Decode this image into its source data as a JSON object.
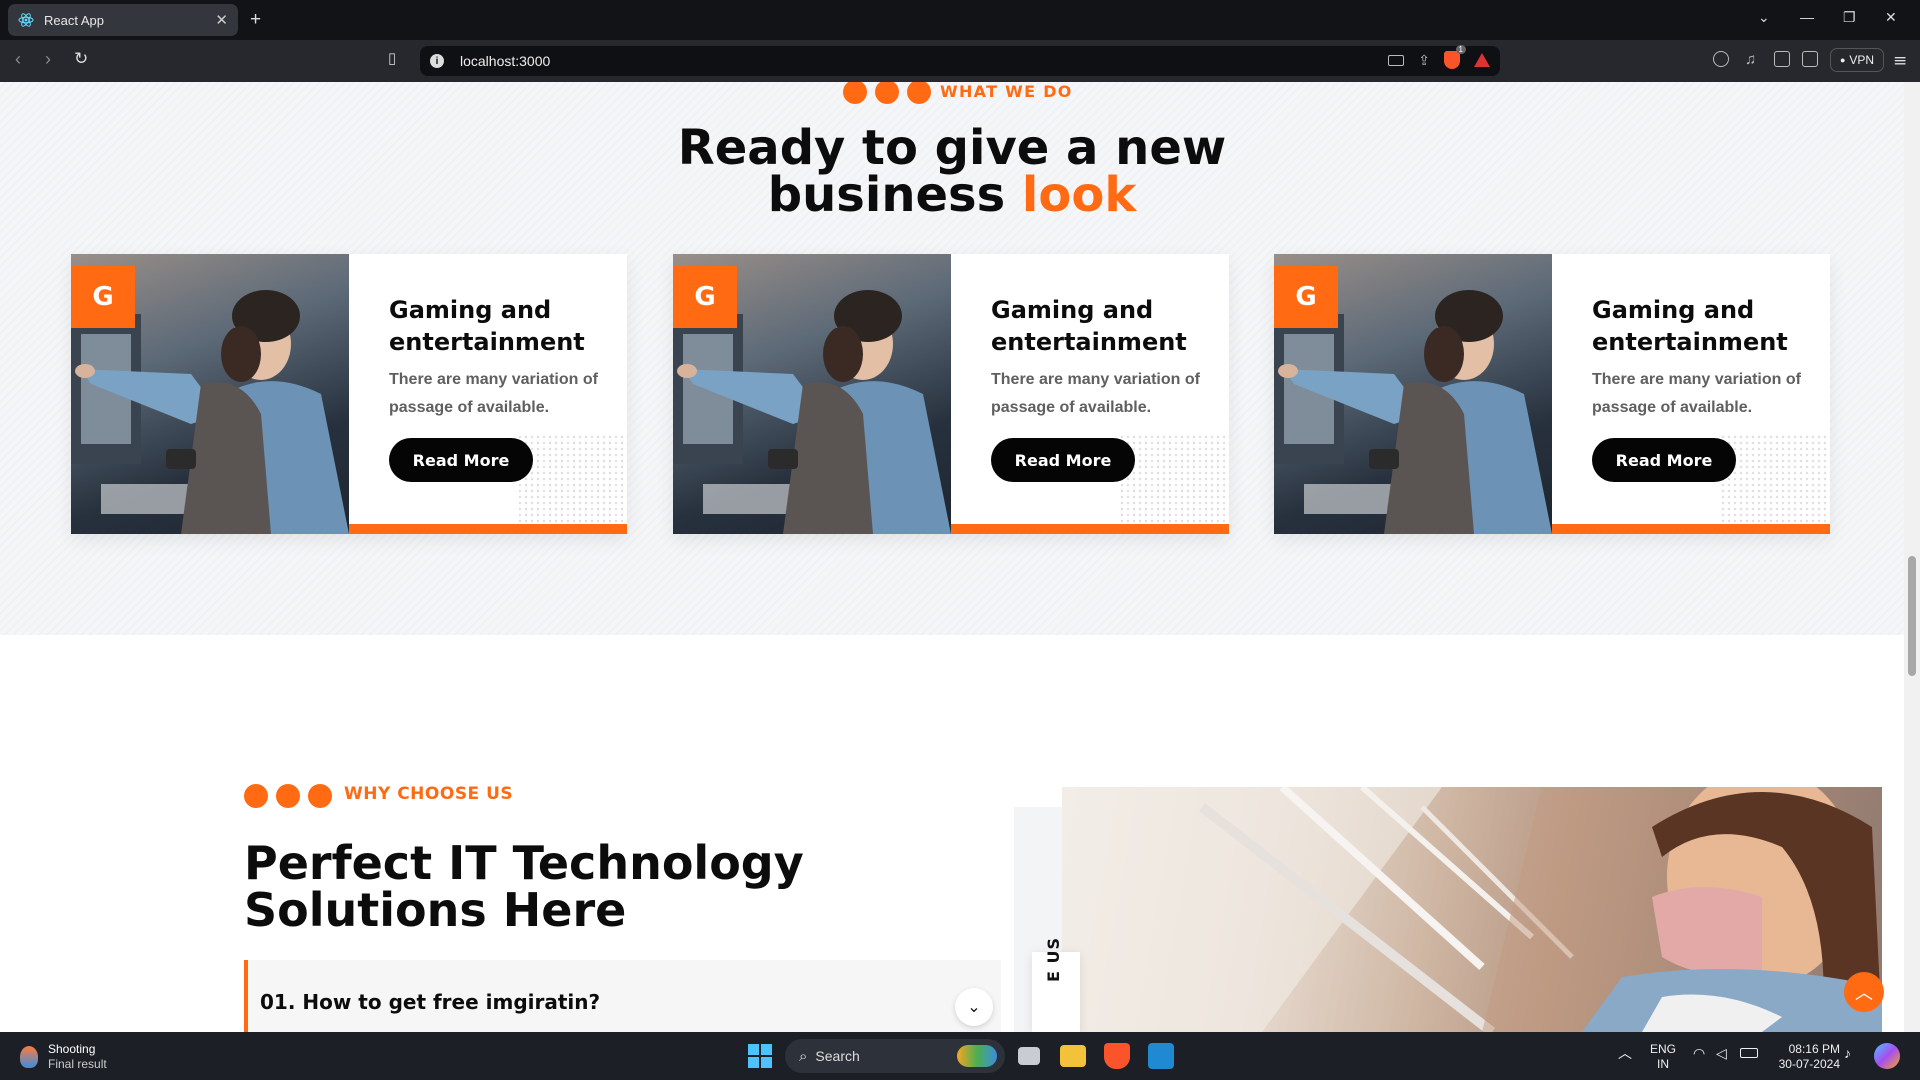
{
  "browser": {
    "tab_title": "React App",
    "tab_close": "✕",
    "new_tab": "+",
    "url": "localhost:3000",
    "vpn_label": "VPN",
    "brave_badge_count": "1"
  },
  "section_services": {
    "eyebrow": "WHAT WE DO",
    "title_line1": "Ready to give a new",
    "title_line2_plain": "business",
    "title_line2_accent": "look",
    "cards": [
      {
        "badge": "G",
        "title": "Gaming and entertainment",
        "description": "There are many variation of passage of available.",
        "button": "Read More"
      },
      {
        "badge": "G",
        "title": "Gaming and entertainment",
        "description": "There are many variation of passage of available.",
        "button": "Read More"
      },
      {
        "badge": "G",
        "title": "Gaming and entertainment",
        "description": "There are many variation of passage of available.",
        "button": "Read More"
      }
    ]
  },
  "section_why": {
    "eyebrow": "WHY CHOOSE US",
    "title_line1": "Perfect IT Technology",
    "title_line2": "Solutions Here",
    "faq_question": "01. How to get free imgiratin?",
    "vertical_label": "E US"
  },
  "taskbar": {
    "weather_title": "Shooting",
    "weather_sub": "Final result",
    "search_label": "Search",
    "lang_top": "ENG",
    "lang_bottom": "IN",
    "time": "08:16 PM",
    "date": "30-07-2024"
  },
  "colors": {
    "accent": "#ff6a13",
    "dark": "#0c0c0c"
  }
}
